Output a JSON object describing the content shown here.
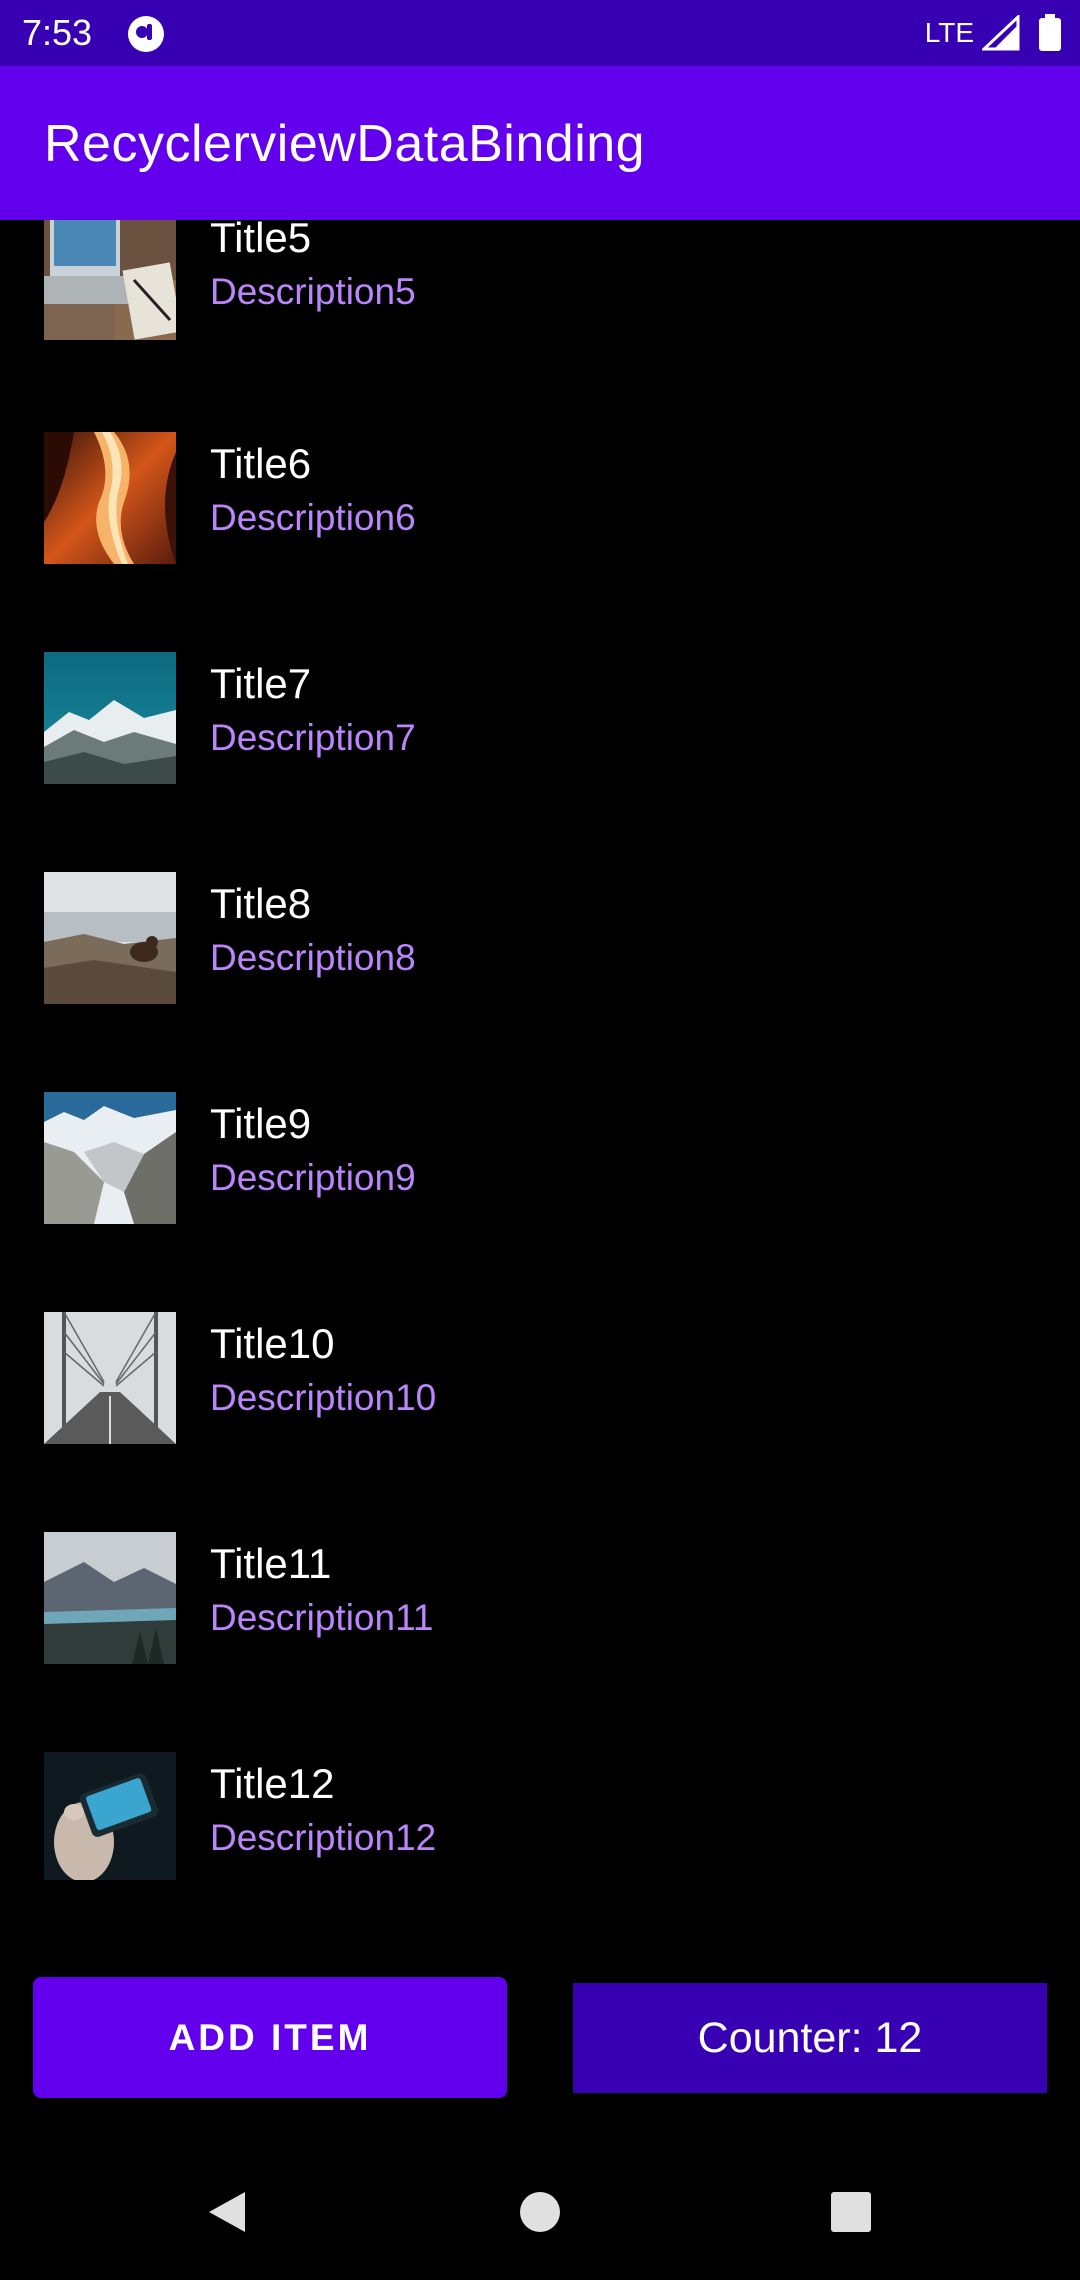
{
  "status_bar": {
    "time": "7:53",
    "network": "LTE",
    "icons": [
      "app-notification-icon",
      "signal-icon",
      "battery-icon"
    ]
  },
  "toolbar": {
    "title": "RecyclerviewDataBinding"
  },
  "list": {
    "items": [
      {
        "title": "Title5",
        "description": "Description5",
        "image": "laptop-desk-photo"
      },
      {
        "title": "Title6",
        "description": "Description6",
        "image": "canyon-photo"
      },
      {
        "title": "Title7",
        "description": "Description7",
        "image": "mountain-lake-photo"
      },
      {
        "title": "Title8",
        "description": "Description8",
        "image": "marmot-photo"
      },
      {
        "title": "Title9",
        "description": "Description9",
        "image": "rocky-valley-photo"
      },
      {
        "title": "Title10",
        "description": "Description10",
        "image": "bridge-photo"
      },
      {
        "title": "Title11",
        "description": "Description11",
        "image": "alpine-lake-photo"
      },
      {
        "title": "Title12",
        "description": "Description12",
        "image": "hand-phone-photo"
      }
    ]
  },
  "actions": {
    "add_item_label": "ADD ITEM",
    "counter_text": "Counter: 12"
  },
  "nav_bar": {
    "icons": [
      "back-icon",
      "home-icon",
      "recents-icon"
    ]
  },
  "colors": {
    "primary": "#6200EE",
    "primary_dark": "#3700B3",
    "accent_text": "#BB86FC",
    "background": "#000000"
  }
}
